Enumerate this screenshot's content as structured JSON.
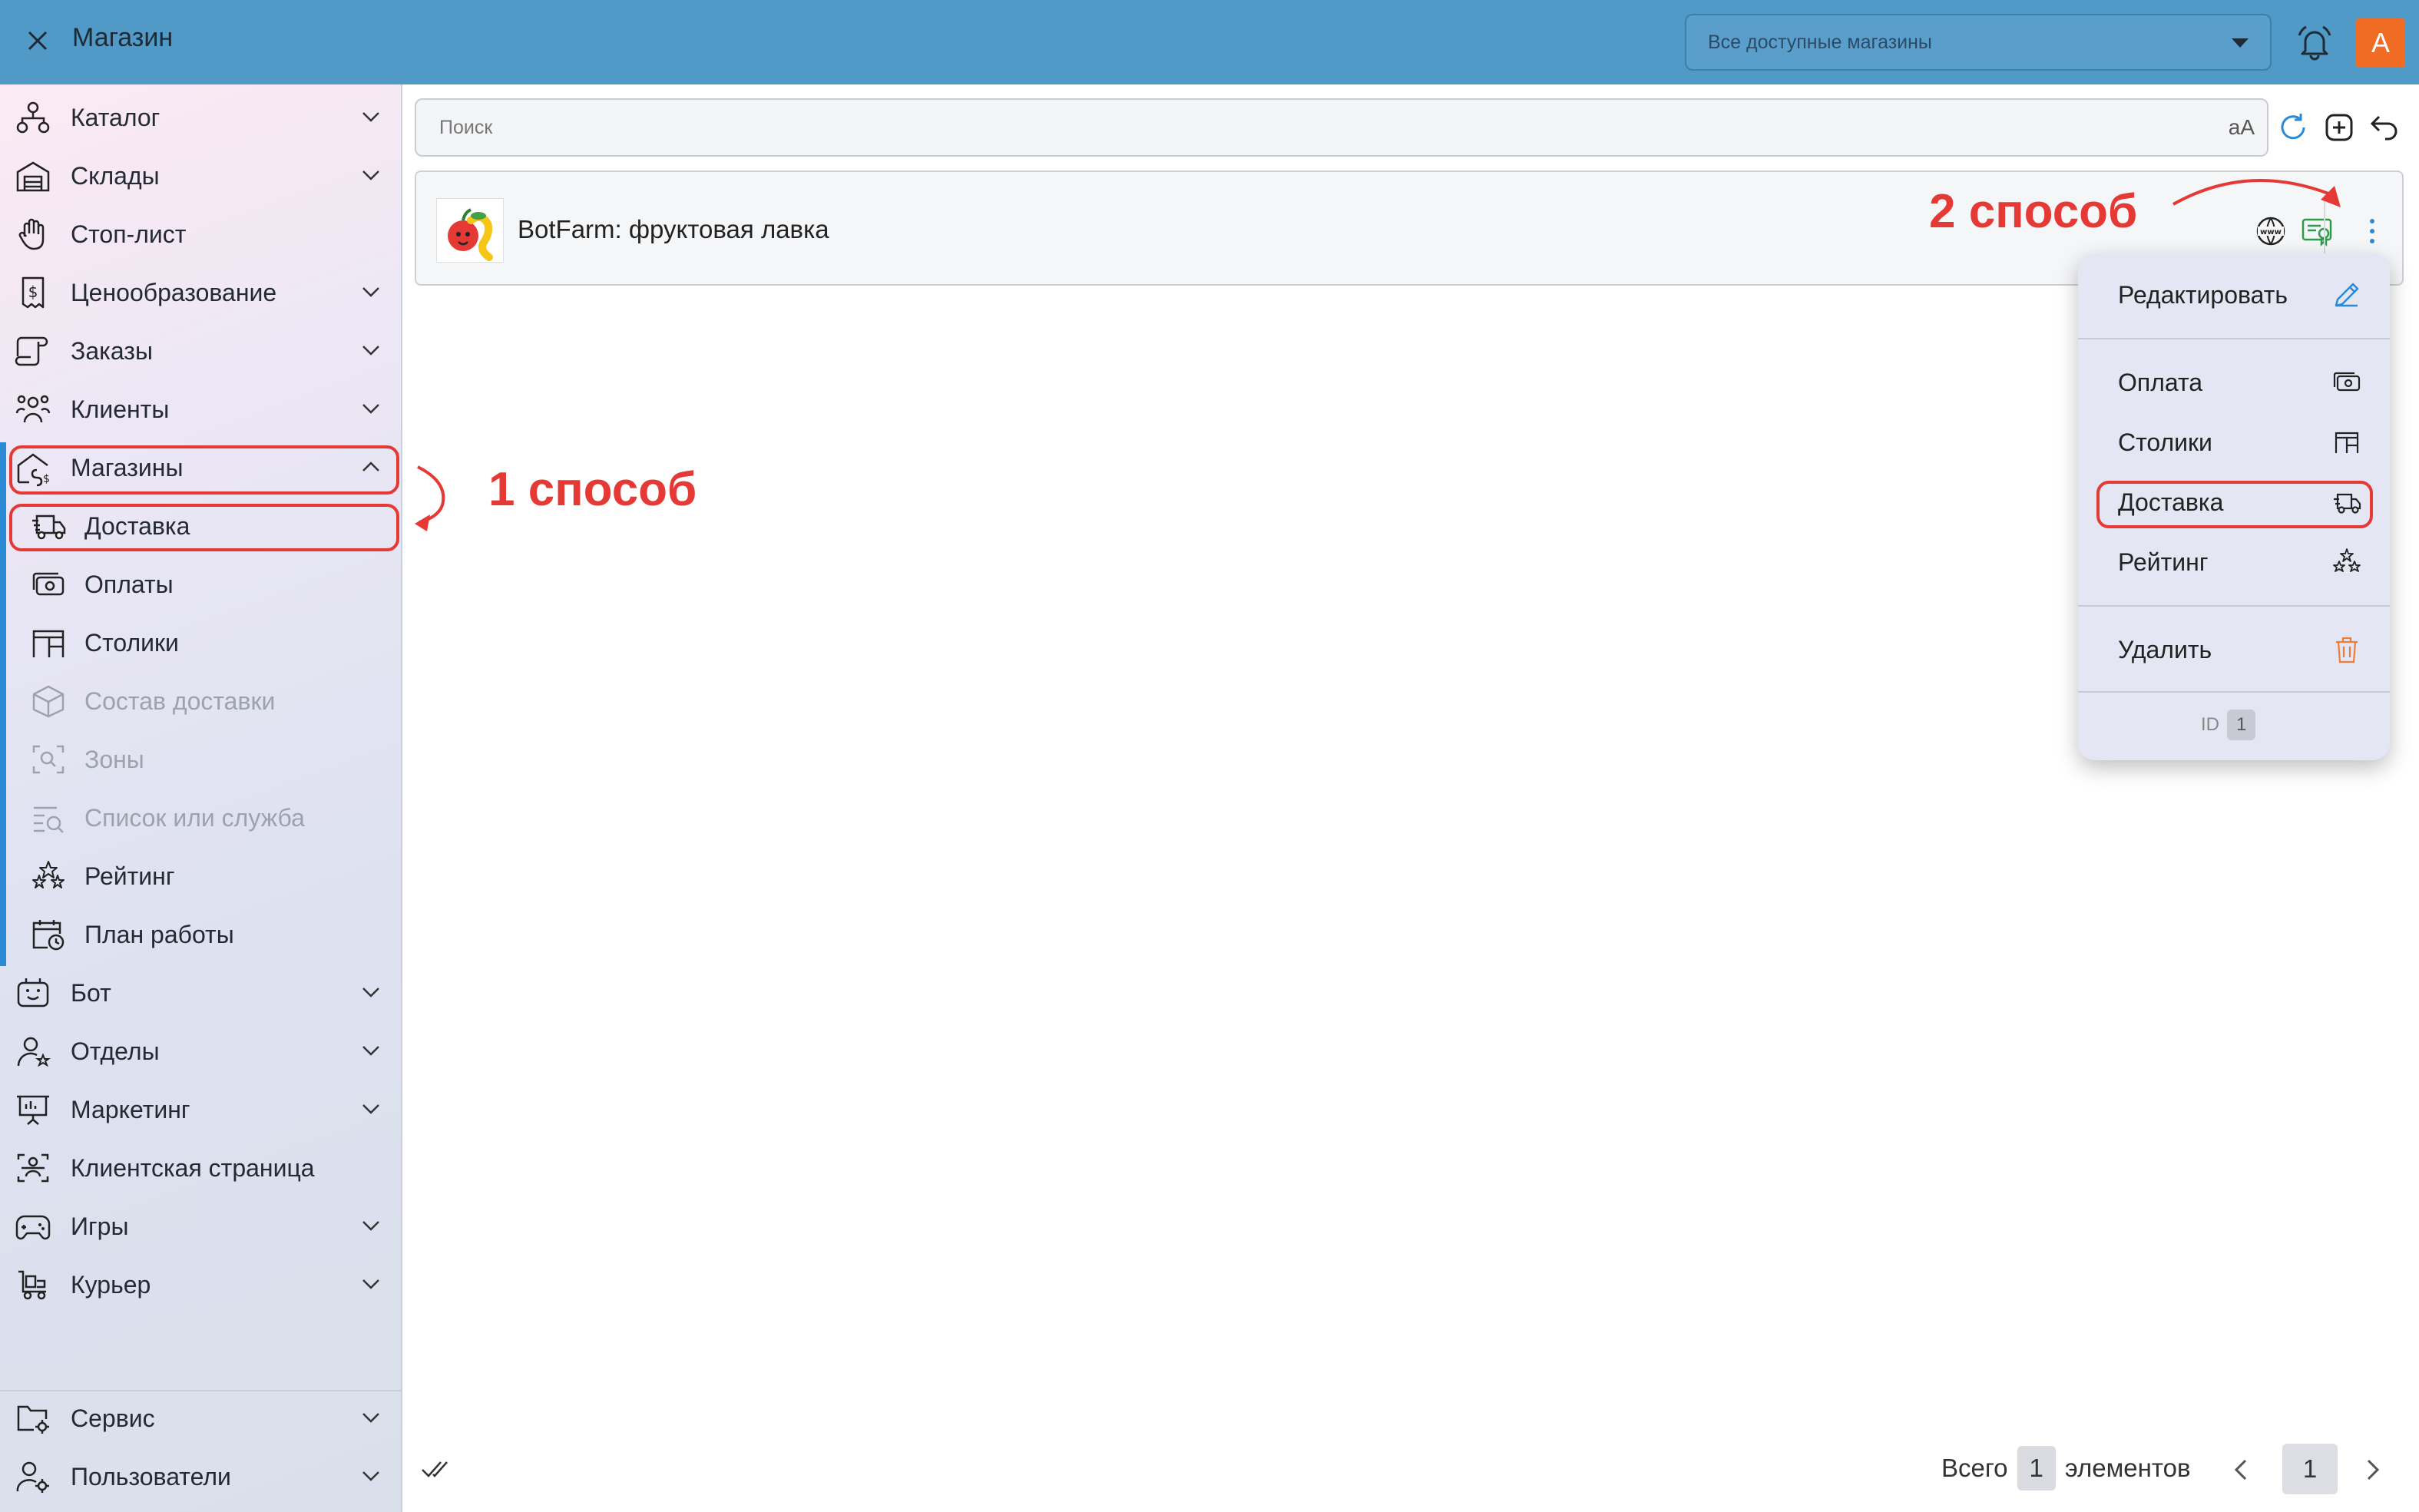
{
  "header": {
    "title": "Магазин",
    "store_select": "Все доступные магазины",
    "avatar_letter": "А"
  },
  "sidebar": {
    "items": [
      {
        "label": "Каталог",
        "icon": "catalog-icon"
      },
      {
        "label": "Склады",
        "icon": "warehouse-icon"
      },
      {
        "label": "Стоп-лист",
        "icon": "hand-stop-icon"
      },
      {
        "label": "Ценообразование",
        "icon": "price-receipt-icon"
      },
      {
        "label": "Заказы",
        "icon": "scroll-orders-icon"
      },
      {
        "label": "Клиенты",
        "icon": "clients-icon"
      },
      {
        "label": "Магазины",
        "icon": "store-home-icon"
      },
      {
        "label": "Доставка",
        "icon": "delivery-truck-icon"
      },
      {
        "label": "Оплаты",
        "icon": "payment-icon"
      },
      {
        "label": "Столики",
        "icon": "table-icon"
      },
      {
        "label": "Состав доставки",
        "icon": "box-icon"
      },
      {
        "label": "Зоны",
        "icon": "zones-icon"
      },
      {
        "label": "Список или служба",
        "icon": "list-search-icon"
      },
      {
        "label": "Рейтинг",
        "icon": "stars-icon"
      },
      {
        "label": "План работы",
        "icon": "calendar-clock-icon"
      },
      {
        "label": "Бот",
        "icon": "bot-icon"
      },
      {
        "label": "Отделы",
        "icon": "departments-icon"
      },
      {
        "label": "Маркетинг",
        "icon": "presentation-icon"
      },
      {
        "label": "Клиентская страница",
        "icon": "client-page-icon"
      },
      {
        "label": "Игры",
        "icon": "gamepad-icon"
      },
      {
        "label": "Курьер",
        "icon": "courier-icon"
      },
      {
        "label": "Сервис",
        "icon": "folder-gear-icon"
      },
      {
        "label": "Пользователи",
        "icon": "user-gear-icon"
      }
    ]
  },
  "search": {
    "placeholder": "Поиск",
    "case_toggle": "aA"
  },
  "store": {
    "name": "BotFarm: фруктовая лавка"
  },
  "annotations": {
    "way1": "1 способ",
    "way2": "2 способ"
  },
  "menu": {
    "edit": "Редактировать",
    "payment": "Оплата",
    "tables": "Столики",
    "delivery": "Доставка",
    "rating": "Рейтинг",
    "delete": "Удалить",
    "id_label": "ID",
    "id_value": "1"
  },
  "footer": {
    "total_label": "Всего",
    "total_count": "1",
    "elements_label": "элементов",
    "page": "1"
  },
  "colors": {
    "topbar": "#5199c6",
    "accent": "#2b8ad6",
    "annotation": "#e53935",
    "avatar": "#ef6c22"
  }
}
